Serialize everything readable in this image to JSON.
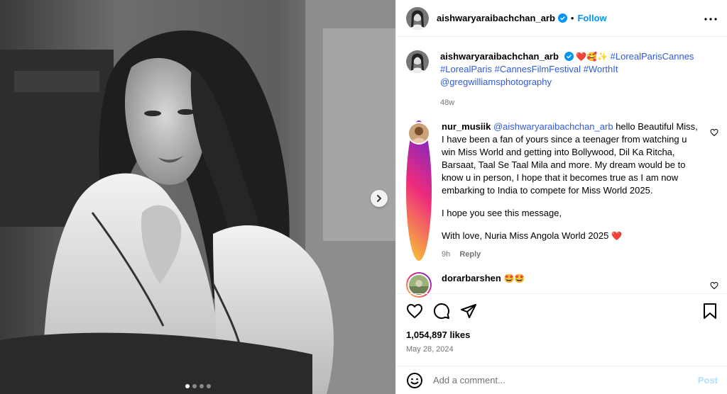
{
  "header": {
    "username": "aishwaryaraibachchan_arb",
    "separator": "•",
    "follow_label": "Follow",
    "more_icon": "more-horizontal-icon"
  },
  "media": {
    "slide_count": 4,
    "active_slide": 1,
    "next_icon": "chevron-right-icon"
  },
  "caption": {
    "username": "aishwaryaraibachchan_arb",
    "emojis": "❤️🥰✨",
    "line1_tag": "#LorealParisCannes",
    "line2": "#LorealParis #CannesFilmFestival #WorthIt",
    "mention": "@gregwilliamsphotography",
    "age": "48w"
  },
  "comments": [
    {
      "username": "nur_musiik",
      "mention": "@aishwaryaraibachchan_arb",
      "paragraph1": "hello Beautiful Miss, I have been a fan of yours since a teenager from watching u win Miss World and getting into Bollywood, Dil Ka Ritcha, Barsaat, Taal Se Taal Mila and more. My dream would be to know u in person, I hope that it becomes true as I am now embarking to India to compete for Miss World 2025.",
      "paragraph2": "I hope you see this message,",
      "paragraph3": "With love, Nuria Miss Angola World 2025",
      "heart": "❤️",
      "age": "9h",
      "reply_label": "Reply"
    },
    {
      "username": "dorarbarshen",
      "text": "🤩🤩"
    }
  ],
  "actions": {
    "icons": [
      "heart-icon",
      "comment-icon",
      "share-icon",
      "bookmark-icon"
    ],
    "likes": "1,054,897 likes",
    "date": "May 28, 2024"
  },
  "add_comment": {
    "placeholder": "Add a comment...",
    "post_label": "Post"
  },
  "colors": {
    "link_blue": "#0095f6",
    "hashtag": "#2e5bda",
    "muted": "#737373",
    "border": "#efefef"
  }
}
